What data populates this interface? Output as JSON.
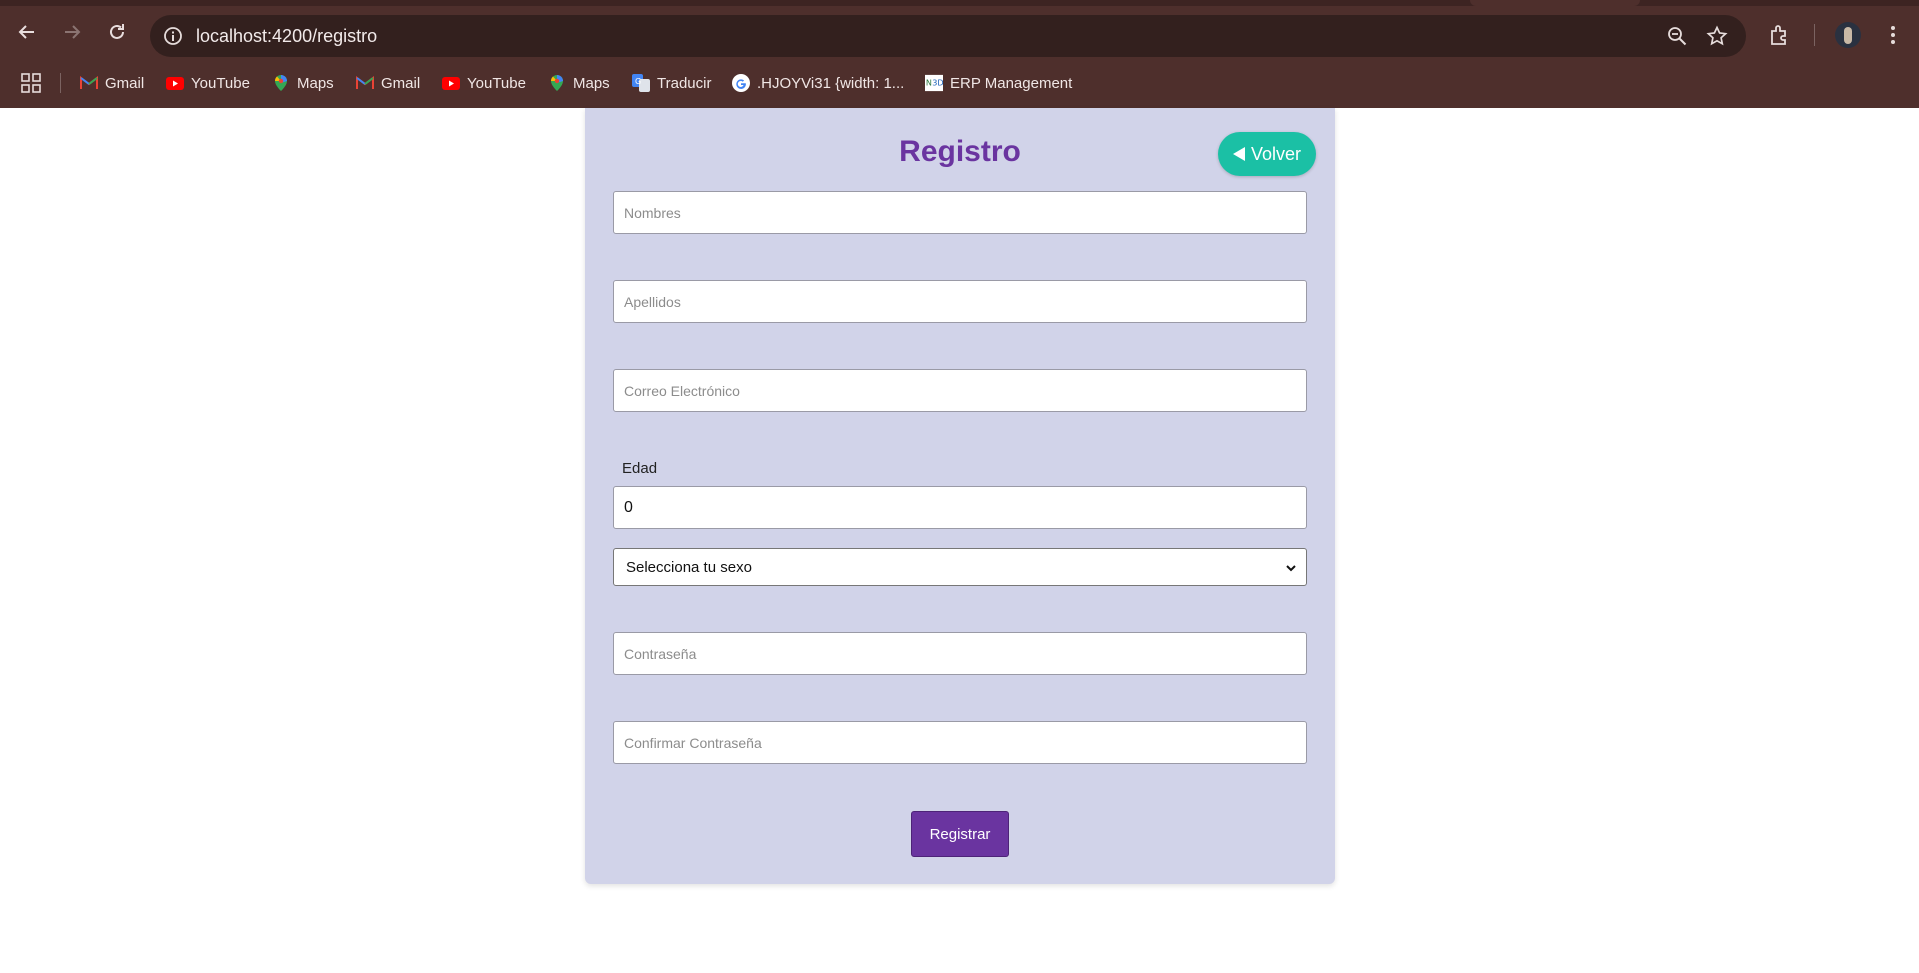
{
  "browser": {
    "url": "localhost:4200/registro",
    "bookmarks": [
      {
        "label": "Gmail",
        "icon": "gmail-icon"
      },
      {
        "label": "YouTube",
        "icon": "youtube-icon"
      },
      {
        "label": "Maps",
        "icon": "maps-icon"
      },
      {
        "label": "Gmail",
        "icon": "gmail-icon"
      },
      {
        "label": "YouTube",
        "icon": "youtube-icon"
      },
      {
        "label": "Maps",
        "icon": "maps-icon"
      },
      {
        "label": "Traducir",
        "icon": "translate-icon"
      },
      {
        "label": ".HJOYVi31 {width: 1...",
        "icon": "google-icon"
      },
      {
        "label": "ERP Management",
        "icon": "erp-icon"
      }
    ]
  },
  "form": {
    "title": "Registro",
    "back_label": "Volver",
    "nombres_placeholder": "Nombres",
    "apellidos_placeholder": "Apellidos",
    "correo_placeholder": "Correo Electrónico",
    "edad_label": "Edad",
    "edad_value": "0",
    "sexo_selected": "Selecciona tu sexo",
    "password_placeholder": "Contraseña",
    "confirm_password_placeholder": "Confirmar Contraseña",
    "submit_label": "Registrar"
  },
  "colors": {
    "card_background": "#d1d3e9",
    "title": "#6a34a0",
    "back_button": "#1bc0a5",
    "submit_button": "#6a34a0",
    "chrome": "#4e2f2c"
  }
}
